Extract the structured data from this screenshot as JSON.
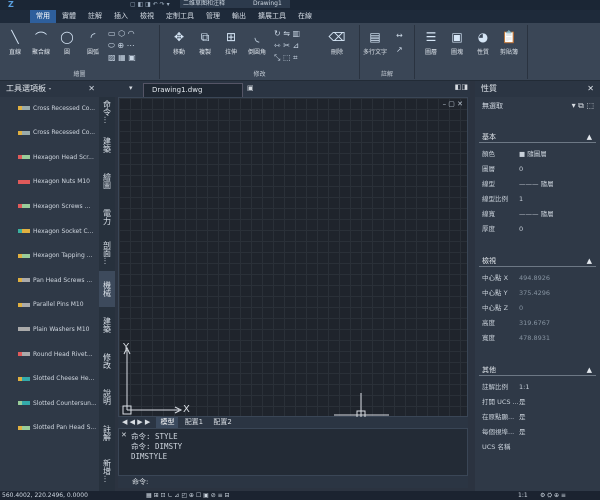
{
  "window": {
    "app_icon": "Z",
    "file_tab": "二维草图和注释",
    "file_tab2": "Drawing1"
  },
  "ribbon_tabs": [
    "常用",
    "實體",
    "註解",
    "插入",
    "檢視",
    "定制工具",
    "管理",
    "輸出",
    "擴展工具",
    "在線"
  ],
  "ribbon_groups": {
    "draw": {
      "title": "繪圖",
      "buttons": [
        "直線",
        "聚合線",
        "圓",
        "圓弧"
      ]
    },
    "modify": {
      "title": "修改",
      "buttons": [
        "移動",
        "複製",
        "拉伸",
        "倒圓角",
        "刪除"
      ]
    },
    "annotation": {
      "title": "註解",
      "buttons": [
        "多行文字"
      ]
    },
    "layers": {
      "buttons": [
        "圖層",
        "圖塊",
        "性質",
        "剪貼簿"
      ]
    }
  },
  "tool_palette": {
    "title": "工具選項板 -",
    "items": [
      "Cross Recessed Co...",
      "Cross Recessed Co...",
      "Hexagon Head Scr...",
      "Hexagon Nuts M10",
      "Hexagon Screws ...",
      "Hexagon Socket C...",
      "Hexagon Tapping ...",
      "Pan Head Screws ...",
      "Parallel Pins M10",
      "Plain Washers M10",
      "Round Head Rivet...",
      "Slotted Cheese He...",
      "Slotted Countersun...",
      "Slotted Pan Head S..."
    ],
    "vtabs": [
      "命令...",
      "建築",
      "繪圖",
      "電力",
      "剖面...",
      "機械",
      "建築",
      "修改",
      "說明",
      "註解",
      "新增..."
    ],
    "active_vtab": 5
  },
  "document": {
    "tab": "Drawing1.dwg"
  },
  "layout_tabs": [
    "模型",
    "配置1",
    "配置2"
  ],
  "command": {
    "history": [
      "命令: STYLE",
      "命令: DIMSTY",
      "DIMSTYLE"
    ],
    "prompt": "命令:"
  },
  "properties": {
    "title": "性質",
    "selection": "無選取",
    "sections": [
      {
        "name": "基本",
        "rows": [
          [
            "顏色",
            "■ 隨圖層"
          ],
          [
            "圖層",
            "0"
          ],
          [
            "線型",
            "——— 隨層"
          ],
          [
            "線型比例",
            "1"
          ],
          [
            "線寬",
            "——— 隨層"
          ],
          [
            "厚度",
            "0"
          ]
        ]
      },
      {
        "name": "檢視",
        "rows": [
          [
            "中心點 X",
            "494.8926"
          ],
          [
            "中心點 Y",
            "375.4296"
          ],
          [
            "中心點 Z",
            "0"
          ],
          [
            "高度",
            "319.6767"
          ],
          [
            "寬度",
            "478.8931"
          ]
        ]
      },
      {
        "name": "其他",
        "rows": [
          [
            "註解比例",
            "1:1"
          ],
          [
            "打開 UCS ...",
            "是"
          ],
          [
            "在原點顯...",
            "是"
          ],
          [
            "每個視埠...",
            "是"
          ],
          [
            "UCS 名稱",
            ""
          ]
        ]
      }
    ]
  },
  "status": {
    "coords": "560.4002, 220.2496, 0.0000",
    "scale": "1:1"
  },
  "axis": {
    "x": "X",
    "y": "Y"
  }
}
